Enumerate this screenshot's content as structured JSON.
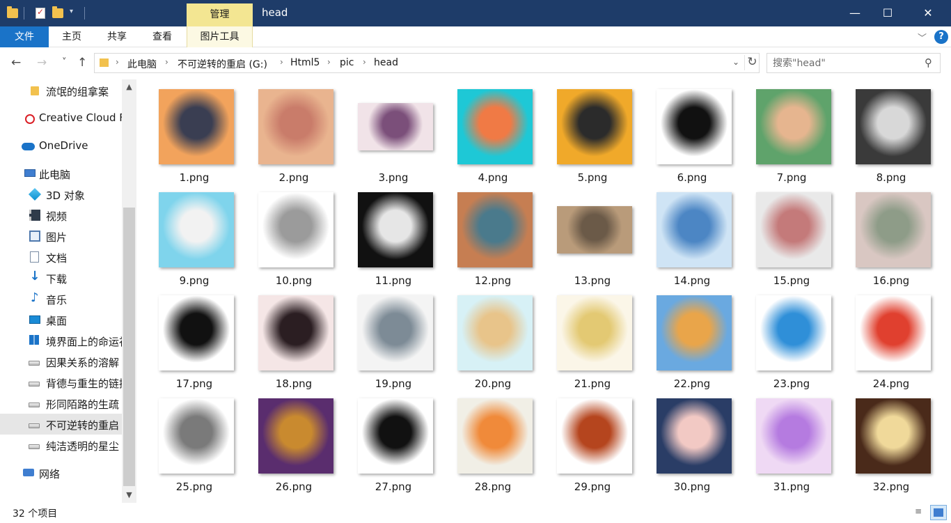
{
  "window": {
    "title": "head",
    "context_tab": "管理",
    "minimize": "—",
    "maximize": "☐",
    "close": "✕"
  },
  "ribbon": {
    "tabs": [
      "文件",
      "主页",
      "共享",
      "查看",
      "图片工具"
    ],
    "expand": "﹀",
    "help": "?"
  },
  "nav": {
    "back": "←",
    "forward": "→",
    "recent": "˅",
    "up": "↑"
  },
  "address": {
    "crumbs": [
      "此电脑",
      "不可逆转的重启 (G:)",
      "Html5",
      "pic",
      "head"
    ],
    "separator": "›",
    "dropdown": "⌄",
    "refresh": "↻"
  },
  "search": {
    "placeholder": "搜索\"head\"",
    "icon": "⚲"
  },
  "navpane": {
    "items": [
      {
        "label": "流氓的组拿案",
        "icon": "folder-icon"
      },
      {
        "label": "Creative Cloud F",
        "icon": "creative-cloud-icon"
      },
      {
        "label": "OneDrive",
        "icon": "onedrive-icon"
      },
      {
        "label": "此电脑",
        "icon": "computer-icon"
      },
      {
        "label": "3D 对象",
        "icon": "3d-objects-icon"
      },
      {
        "label": "视频",
        "icon": "video-icon"
      },
      {
        "label": "图片",
        "icon": "pictures-icon"
      },
      {
        "label": "文档",
        "icon": "documents-icon"
      },
      {
        "label": "下载",
        "icon": "downloads-icon"
      },
      {
        "label": "音乐",
        "icon": "music-icon"
      },
      {
        "label": "桌面",
        "icon": "desktop-icon"
      },
      {
        "label": "境界面上的命运祈",
        "icon": "windows-drive-icon"
      },
      {
        "label": "因果关系的溶解",
        "icon": "drive-icon"
      },
      {
        "label": "背德与重生的链接",
        "icon": "drive-icon"
      },
      {
        "label": "形同陌路的生疏",
        "icon": "drive-icon"
      },
      {
        "label": "不可逆转的重启",
        "icon": "drive-icon"
      },
      {
        "label": "纯洁透明的星尘",
        "icon": "drive-icon"
      },
      {
        "label": "网络",
        "icon": "network-icon"
      }
    ],
    "selected_index": 15,
    "scroll_up": "▲",
    "scroll_down": "▼"
  },
  "files": [
    {
      "name": "1.png",
      "colors": [
        "#f2a35c",
        "#3a3e52"
      ]
    },
    {
      "name": "2.png",
      "colors": [
        "#e9b48f",
        "#c97c6a"
      ]
    },
    {
      "name": "3.png",
      "colors": [
        "#f1e3e8",
        "#7b4f7a"
      ]
    },
    {
      "name": "4.png",
      "colors": [
        "#1ec8d6",
        "#f07a45"
      ]
    },
    {
      "name": "5.png",
      "colors": [
        "#f0a92a",
        "#2b2b2b"
      ]
    },
    {
      "name": "6.png",
      "colors": [
        "#ffffff",
        "#111111"
      ]
    },
    {
      "name": "7.png",
      "colors": [
        "#5fa36b",
        "#e6b58f"
      ]
    },
    {
      "name": "8.png",
      "colors": [
        "#3a3a3a",
        "#d8d8d8"
      ]
    },
    {
      "name": "9.png",
      "colors": [
        "#7fd4ec",
        "#f2f2f2"
      ]
    },
    {
      "name": "10.png",
      "colors": [
        "#ffffff",
        "#9b9b9b"
      ]
    },
    {
      "name": "11.png",
      "colors": [
        "#111111",
        "#e6e6e6"
      ]
    },
    {
      "name": "12.png",
      "colors": [
        "#c67e52",
        "#4a7a8c"
      ]
    },
    {
      "name": "13.png",
      "colors": [
        "#b99b7a",
        "#6b5a48"
      ]
    },
    {
      "name": "14.png",
      "colors": [
        "#cfe4f5",
        "#4c86c4"
      ]
    },
    {
      "name": "15.png",
      "colors": [
        "#e9e9e9",
        "#c47a7a"
      ]
    },
    {
      "name": "16.png",
      "colors": [
        "#d9c7c2",
        "#8e9c88"
      ]
    },
    {
      "name": "17.png",
      "colors": [
        "#ffffff",
        "#111111"
      ]
    },
    {
      "name": "18.png",
      "colors": [
        "#f5e6e6",
        "#2b1e22"
      ]
    },
    {
      "name": "19.png",
      "colors": [
        "#f4f4f4",
        "#7d8b96"
      ]
    },
    {
      "name": "20.png",
      "colors": [
        "#d7f1f6",
        "#e8c48a"
      ]
    },
    {
      "name": "21.png",
      "colors": [
        "#fbf6e8",
        "#e3c973"
      ]
    },
    {
      "name": "22.png",
      "colors": [
        "#6aa9e0",
        "#e9a54a"
      ]
    },
    {
      "name": "23.png",
      "colors": [
        "#ffffff",
        "#2f8fd8"
      ]
    },
    {
      "name": "24.png",
      "colors": [
        "#ffffff",
        "#e0402f"
      ]
    },
    {
      "name": "25.png",
      "colors": [
        "#ffffff",
        "#7a7a7a"
      ]
    },
    {
      "name": "26.png",
      "colors": [
        "#5a2d6e",
        "#c98a2f"
      ]
    },
    {
      "name": "27.png",
      "colors": [
        "#ffffff",
        "#111111"
      ]
    },
    {
      "name": "28.png",
      "colors": [
        "#f1efe6",
        "#f08a3a"
      ]
    },
    {
      "name": "29.png",
      "colors": [
        "#ffffff",
        "#b5451e"
      ]
    },
    {
      "name": "30.png",
      "colors": [
        "#2a3d66",
        "#f2c9c4"
      ]
    },
    {
      "name": "31.png",
      "colors": [
        "#efd9f4",
        "#b57be0"
      ]
    },
    {
      "name": "32.png",
      "colors": [
        "#4a2a1a",
        "#f0d99a"
      ]
    }
  ],
  "status": {
    "count": "32 个项目",
    "details_icon": "≡"
  },
  "colors": {
    "titlebar": "#1e3c69",
    "file_tab": "#1a73c8",
    "context_tab": "#f3e692",
    "selection": "#e6e6e6"
  }
}
